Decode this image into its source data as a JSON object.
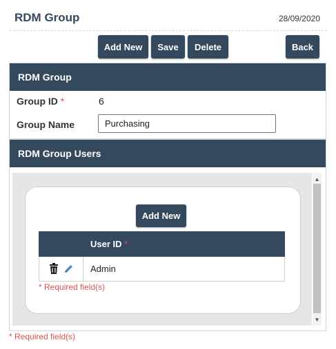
{
  "header": {
    "title": "RDM Group",
    "date": "28/09/2020"
  },
  "toolbar": {
    "add_new_label": "Add New",
    "save_label": "Save",
    "delete_label": "Delete",
    "back_label": "Back"
  },
  "group_panel": {
    "title": "RDM Group",
    "group_id_label": "Group ID",
    "group_id_required": "*",
    "group_id_value": "6",
    "group_name_label": "Group Name",
    "group_name_value": "Purchasing"
  },
  "users_panel": {
    "title": "RDM Group Users",
    "add_new_label": "Add New",
    "grid": {
      "header": "User ID",
      "header_required": "*",
      "rows": [
        {
          "user_id": "Admin"
        }
      ]
    },
    "required_note": "* Required field(s)"
  },
  "footer": {
    "required_note": "* Required field(s)"
  },
  "colors": {
    "primary": "#34495e",
    "required": "#d9534f",
    "pencil": "#4a8fc8"
  }
}
